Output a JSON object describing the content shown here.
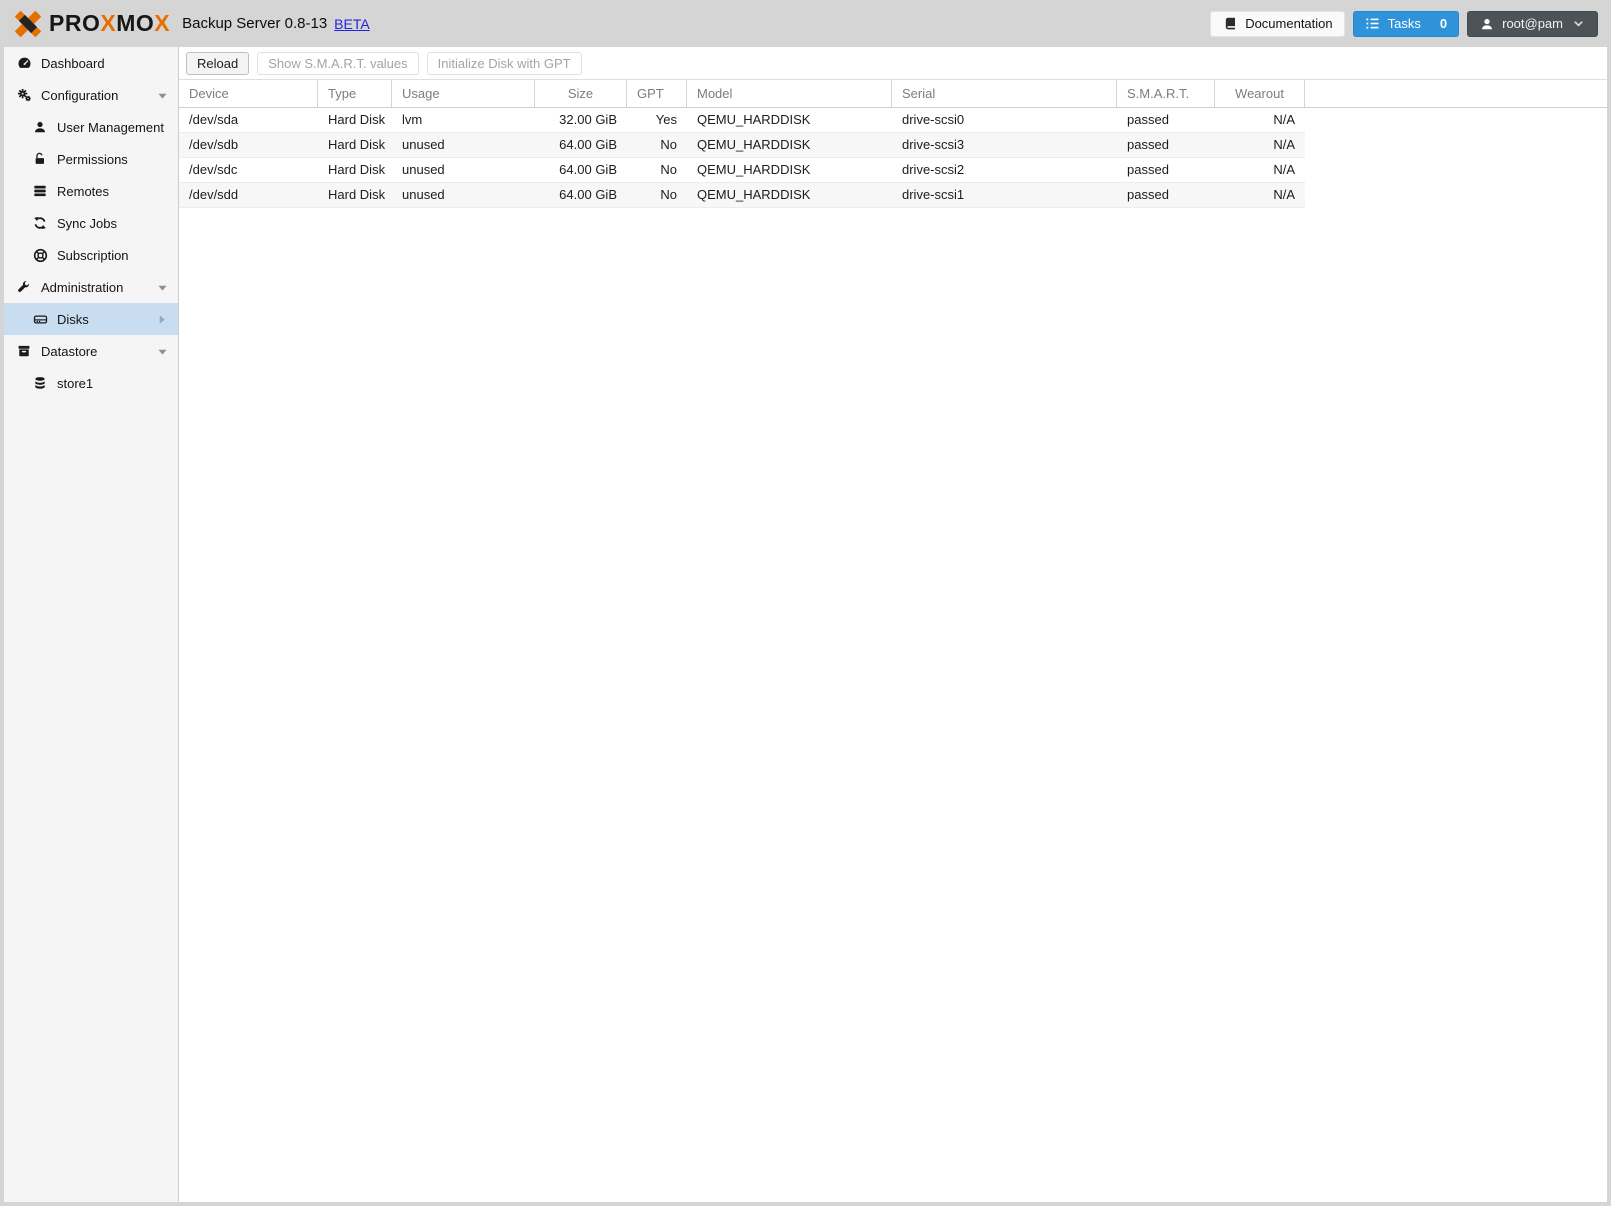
{
  "header": {
    "logo": {
      "p1": "PRO",
      "x1": "X",
      "p2": "MO",
      "x2": "X"
    },
    "title": "Backup Server 0.8-13",
    "beta": "BETA",
    "documentation_label": "Documentation",
    "tasks_label": "Tasks",
    "tasks_count": "0",
    "user": "root@pam"
  },
  "sidebar": {
    "items": [
      {
        "label": "Dashboard",
        "icon": "dashboard-icon"
      },
      {
        "label": "Configuration",
        "icon": "gears-icon"
      },
      {
        "label": "User Management",
        "icon": "user-icon"
      },
      {
        "label": "Permissions",
        "icon": "unlock-icon"
      },
      {
        "label": "Remotes",
        "icon": "server-icon"
      },
      {
        "label": "Sync Jobs",
        "icon": "sync-icon"
      },
      {
        "label": "Subscription",
        "icon": "life-ring-icon"
      },
      {
        "label": "Administration",
        "icon": "wrench-icon"
      },
      {
        "label": "Disks",
        "icon": "hdd-icon",
        "selected": true
      },
      {
        "label": "Datastore",
        "icon": "archive-icon"
      },
      {
        "label": "store1",
        "icon": "database-icon"
      }
    ]
  },
  "toolbar": {
    "reload_label": "Reload",
    "smart_label": "Show S.M.A.R.T. values",
    "gpt_label": "Initialize Disk with GPT"
  },
  "table": {
    "columns": [
      "Device",
      "Type",
      "Usage",
      "Size",
      "GPT",
      "Model",
      "Serial",
      "S.M.A.R.T.",
      "Wearout"
    ],
    "rows": [
      {
        "device": "/dev/sda",
        "type": "Hard Disk",
        "usage": "lvm",
        "size": "32.00 GiB",
        "gpt": "Yes",
        "model": "QEMU_HARDDISK",
        "serial": "drive-scsi0",
        "smart": "passed",
        "wearout": "N/A"
      },
      {
        "device": "/dev/sdb",
        "type": "Hard Disk",
        "usage": "unused",
        "size": "64.00 GiB",
        "gpt": "No",
        "model": "QEMU_HARDDISK",
        "serial": "drive-scsi3",
        "smart": "passed",
        "wearout": "N/A"
      },
      {
        "device": "/dev/sdc",
        "type": "Hard Disk",
        "usage": "unused",
        "size": "64.00 GiB",
        "gpt": "No",
        "model": "QEMU_HARDDISK",
        "serial": "drive-scsi2",
        "smart": "passed",
        "wearout": "N/A"
      },
      {
        "device": "/dev/sdd",
        "type": "Hard Disk",
        "usage": "unused",
        "size": "64.00 GiB",
        "gpt": "No",
        "model": "QEMU_HARDDISK",
        "serial": "drive-scsi1",
        "smart": "passed",
        "wearout": "N/A"
      }
    ]
  },
  "colors": {
    "accent_blue": "#2f93da",
    "logo_orange": "#e57000",
    "selected_row_bg": "#c8ddf0",
    "user_button_bg": "#4d5458"
  }
}
